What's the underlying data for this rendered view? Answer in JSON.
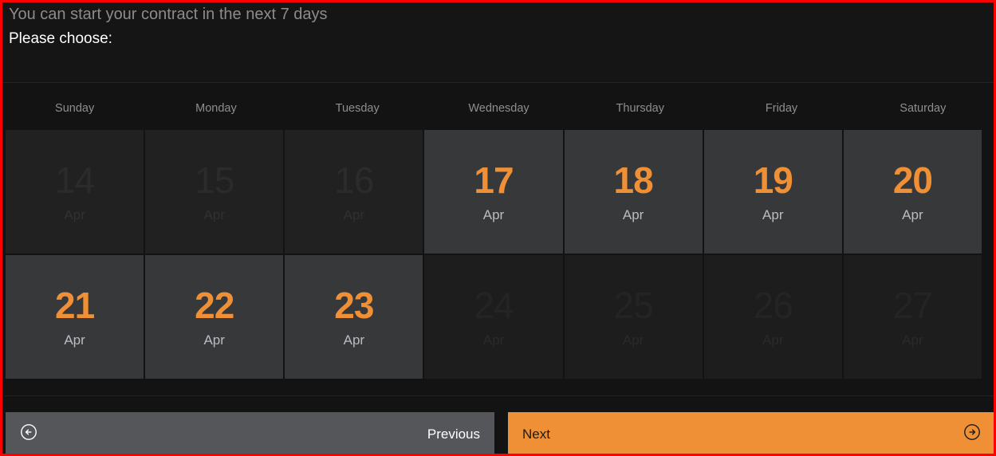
{
  "header": {
    "line1": "You can start your contract in the next 7 days",
    "line2": "Please choose:"
  },
  "weekdays": [
    {
      "label": "Sunday"
    },
    {
      "label": "Monday"
    },
    {
      "label": "Tuesday"
    },
    {
      "label": "Wednesday"
    },
    {
      "label": "Thursday"
    },
    {
      "label": "Friday"
    },
    {
      "label": "Saturday"
    }
  ],
  "calendar": {
    "rows": [
      [
        {
          "day": "14",
          "month": "Apr",
          "state": "disabled-a"
        },
        {
          "day": "15",
          "month": "Apr",
          "state": "disabled-a"
        },
        {
          "day": "16",
          "month": "Apr",
          "state": "disabled-a"
        },
        {
          "day": "17",
          "month": "Apr",
          "state": "enabled"
        },
        {
          "day": "18",
          "month": "Apr",
          "state": "enabled"
        },
        {
          "day": "19",
          "month": "Apr",
          "state": "enabled"
        },
        {
          "day": "20",
          "month": "Apr",
          "state": "enabled"
        }
      ],
      [
        {
          "day": "21",
          "month": "Apr",
          "state": "enabled"
        },
        {
          "day": "22",
          "month": "Apr",
          "state": "enabled"
        },
        {
          "day": "23",
          "month": "Apr",
          "state": "enabled"
        },
        {
          "day": "24",
          "month": "Apr",
          "state": "disabled-b"
        },
        {
          "day": "25",
          "month": "Apr",
          "state": "disabled-b"
        },
        {
          "day": "26",
          "month": "Apr",
          "state": "disabled-b"
        },
        {
          "day": "27",
          "month": "Apr",
          "state": "disabled-b"
        }
      ]
    ]
  },
  "footer": {
    "previous_label": "Previous",
    "previous_icon": "arrow-left-circle-icon",
    "next_label": "Next",
    "next_icon": "arrow-right-circle-icon"
  },
  "colors": {
    "accent_orange": "#ef9036",
    "page_background": "#131313",
    "cell_enabled": "#37383a",
    "cell_disabled_upper": "#212121",
    "cell_disabled_lower": "#1d1d1d",
    "border_red": "#ff0000",
    "previous_button": "#555659"
  }
}
